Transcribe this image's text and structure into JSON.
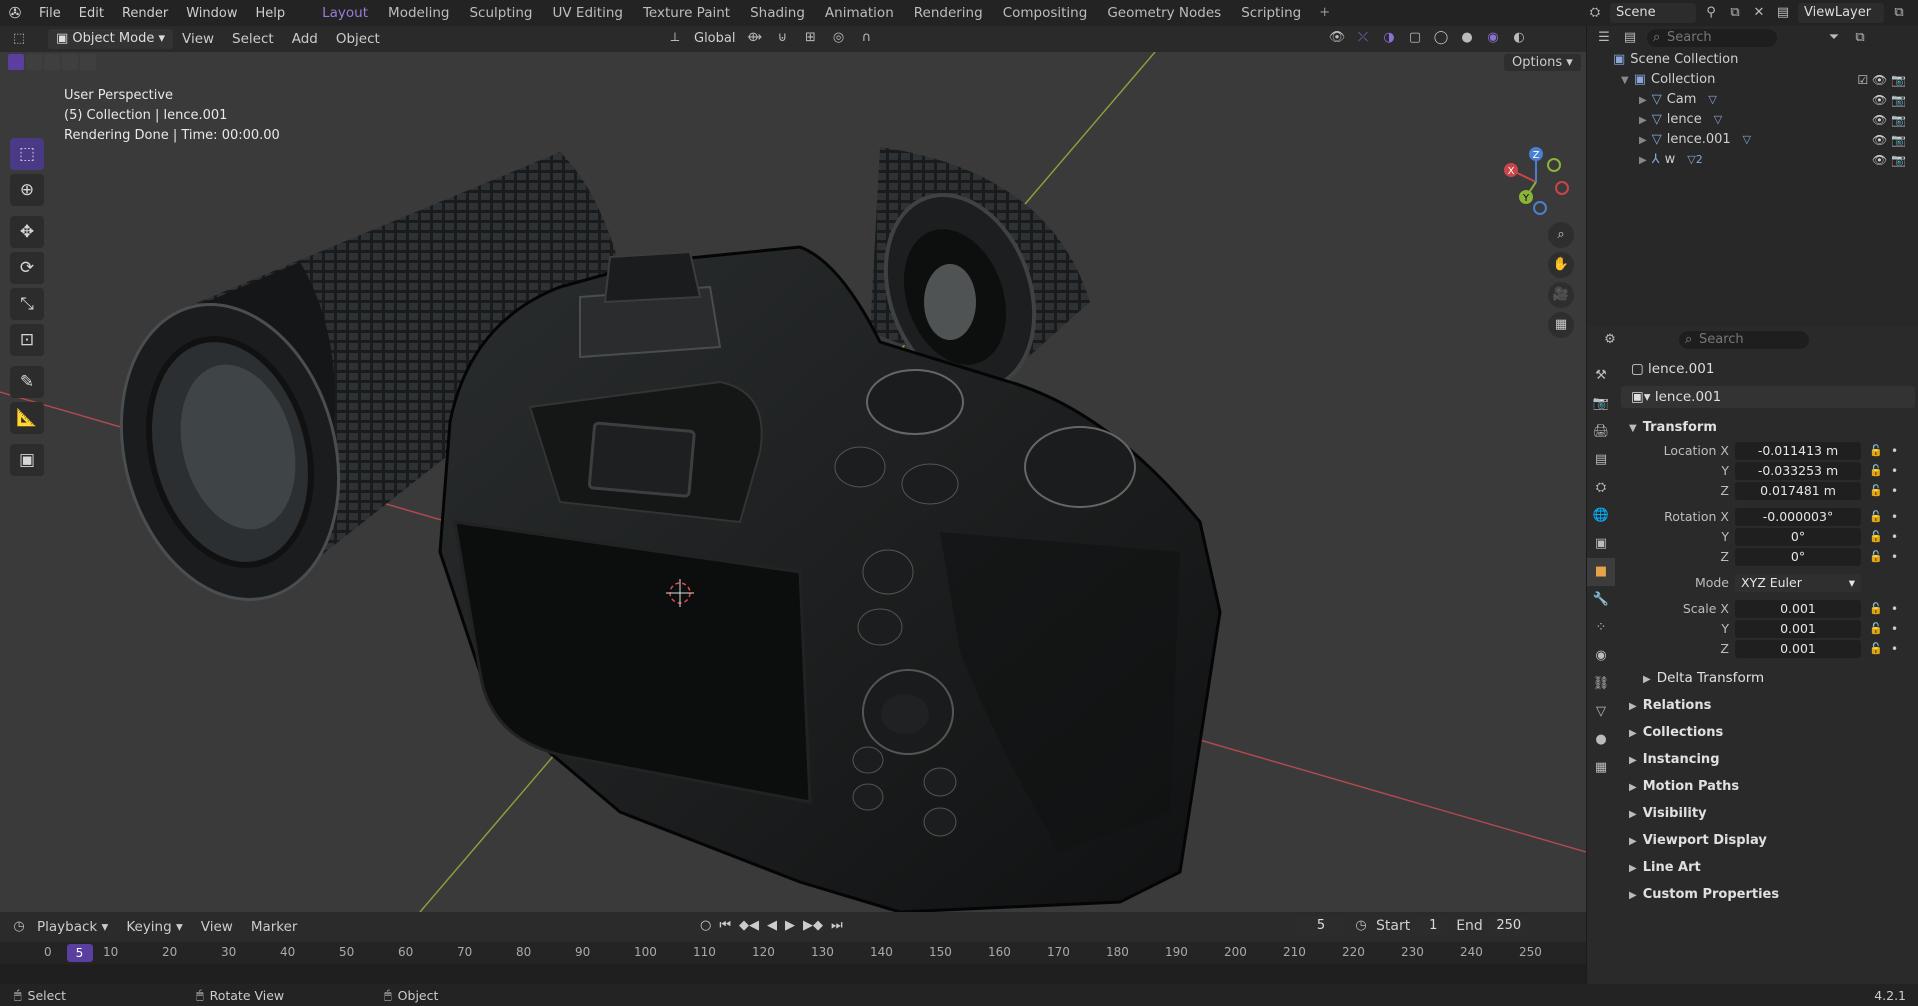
{
  "topbar": {
    "menus": [
      "File",
      "Edit",
      "Render",
      "Window",
      "Help"
    ],
    "workspaces": [
      "Layout",
      "Modeling",
      "Sculpting",
      "UV Editing",
      "Texture Paint",
      "Shading",
      "Animation",
      "Rendering",
      "Compositing",
      "Geometry Nodes",
      "Scripting"
    ],
    "active_workspace": "Layout",
    "scene": "Scene",
    "view_layer": "ViewLayer"
  },
  "viewport_header": {
    "mode": "Object Mode",
    "menus": [
      "View",
      "Select",
      "Add",
      "Object"
    ],
    "orientation": "Global",
    "options": "Options"
  },
  "viewport": {
    "info_lines": [
      "User Perspective",
      "(5) Collection | lence.001",
      "Rendering Done | Time: 00:00.00"
    ],
    "gizmo_axes": [
      "X",
      "Y",
      "Z"
    ],
    "colors": {
      "x_axis": "#c8454a",
      "y_axis": "#8bb33a",
      "z_axis": "#4a7fd1",
      "accent": "#5a3fa0"
    }
  },
  "timeline": {
    "menus": [
      "Playback",
      "Keying",
      "View",
      "Marker"
    ],
    "current_frame": "5",
    "start_label": "Start",
    "start": "1",
    "end_label": "End",
    "end": "250",
    "ticks": [
      "0",
      "10",
      "20",
      "30",
      "40",
      "50",
      "60",
      "70",
      "80",
      "90",
      "100",
      "110",
      "120",
      "130",
      "140",
      "150",
      "160",
      "170",
      "180",
      "190",
      "200",
      "210",
      "220",
      "230",
      "240",
      "250"
    ]
  },
  "statusbar": {
    "items": [
      "Select",
      "Rotate View",
      "Object"
    ],
    "version": "4.2.1"
  },
  "outliner": {
    "search_placeholder": "Search",
    "scene_collection": "Scene Collection",
    "collection": "Collection",
    "items": [
      {
        "name": "Cam"
      },
      {
        "name": "lence"
      },
      {
        "name": "lence.001"
      },
      {
        "name": "w",
        "modifier": "2"
      }
    ]
  },
  "properties": {
    "search_placeholder": "Search",
    "object_name": "lence.001",
    "data_name": "lence.001",
    "transform_title": "Transform",
    "location": {
      "label": "Location X",
      "x": "-0.011413 m",
      "y": "-0.033253 m",
      "z": "0.017481 m"
    },
    "rotation": {
      "label": "Rotation X",
      "x": "-0.000003°",
      "y": "0°",
      "z": "0°"
    },
    "mode": {
      "label": "Mode",
      "value": "XYZ Euler"
    },
    "scale": {
      "label": "Scale X",
      "x": "0.001",
      "y": "0.001",
      "z": "0.001"
    },
    "axis_y": "Y",
    "axis_z": "Z",
    "sub_panel": "Delta Transform",
    "panels": [
      "Relations",
      "Collections",
      "Instancing",
      "Motion Paths",
      "Visibility",
      "Viewport Display",
      "Line Art",
      "Custom Properties"
    ]
  }
}
